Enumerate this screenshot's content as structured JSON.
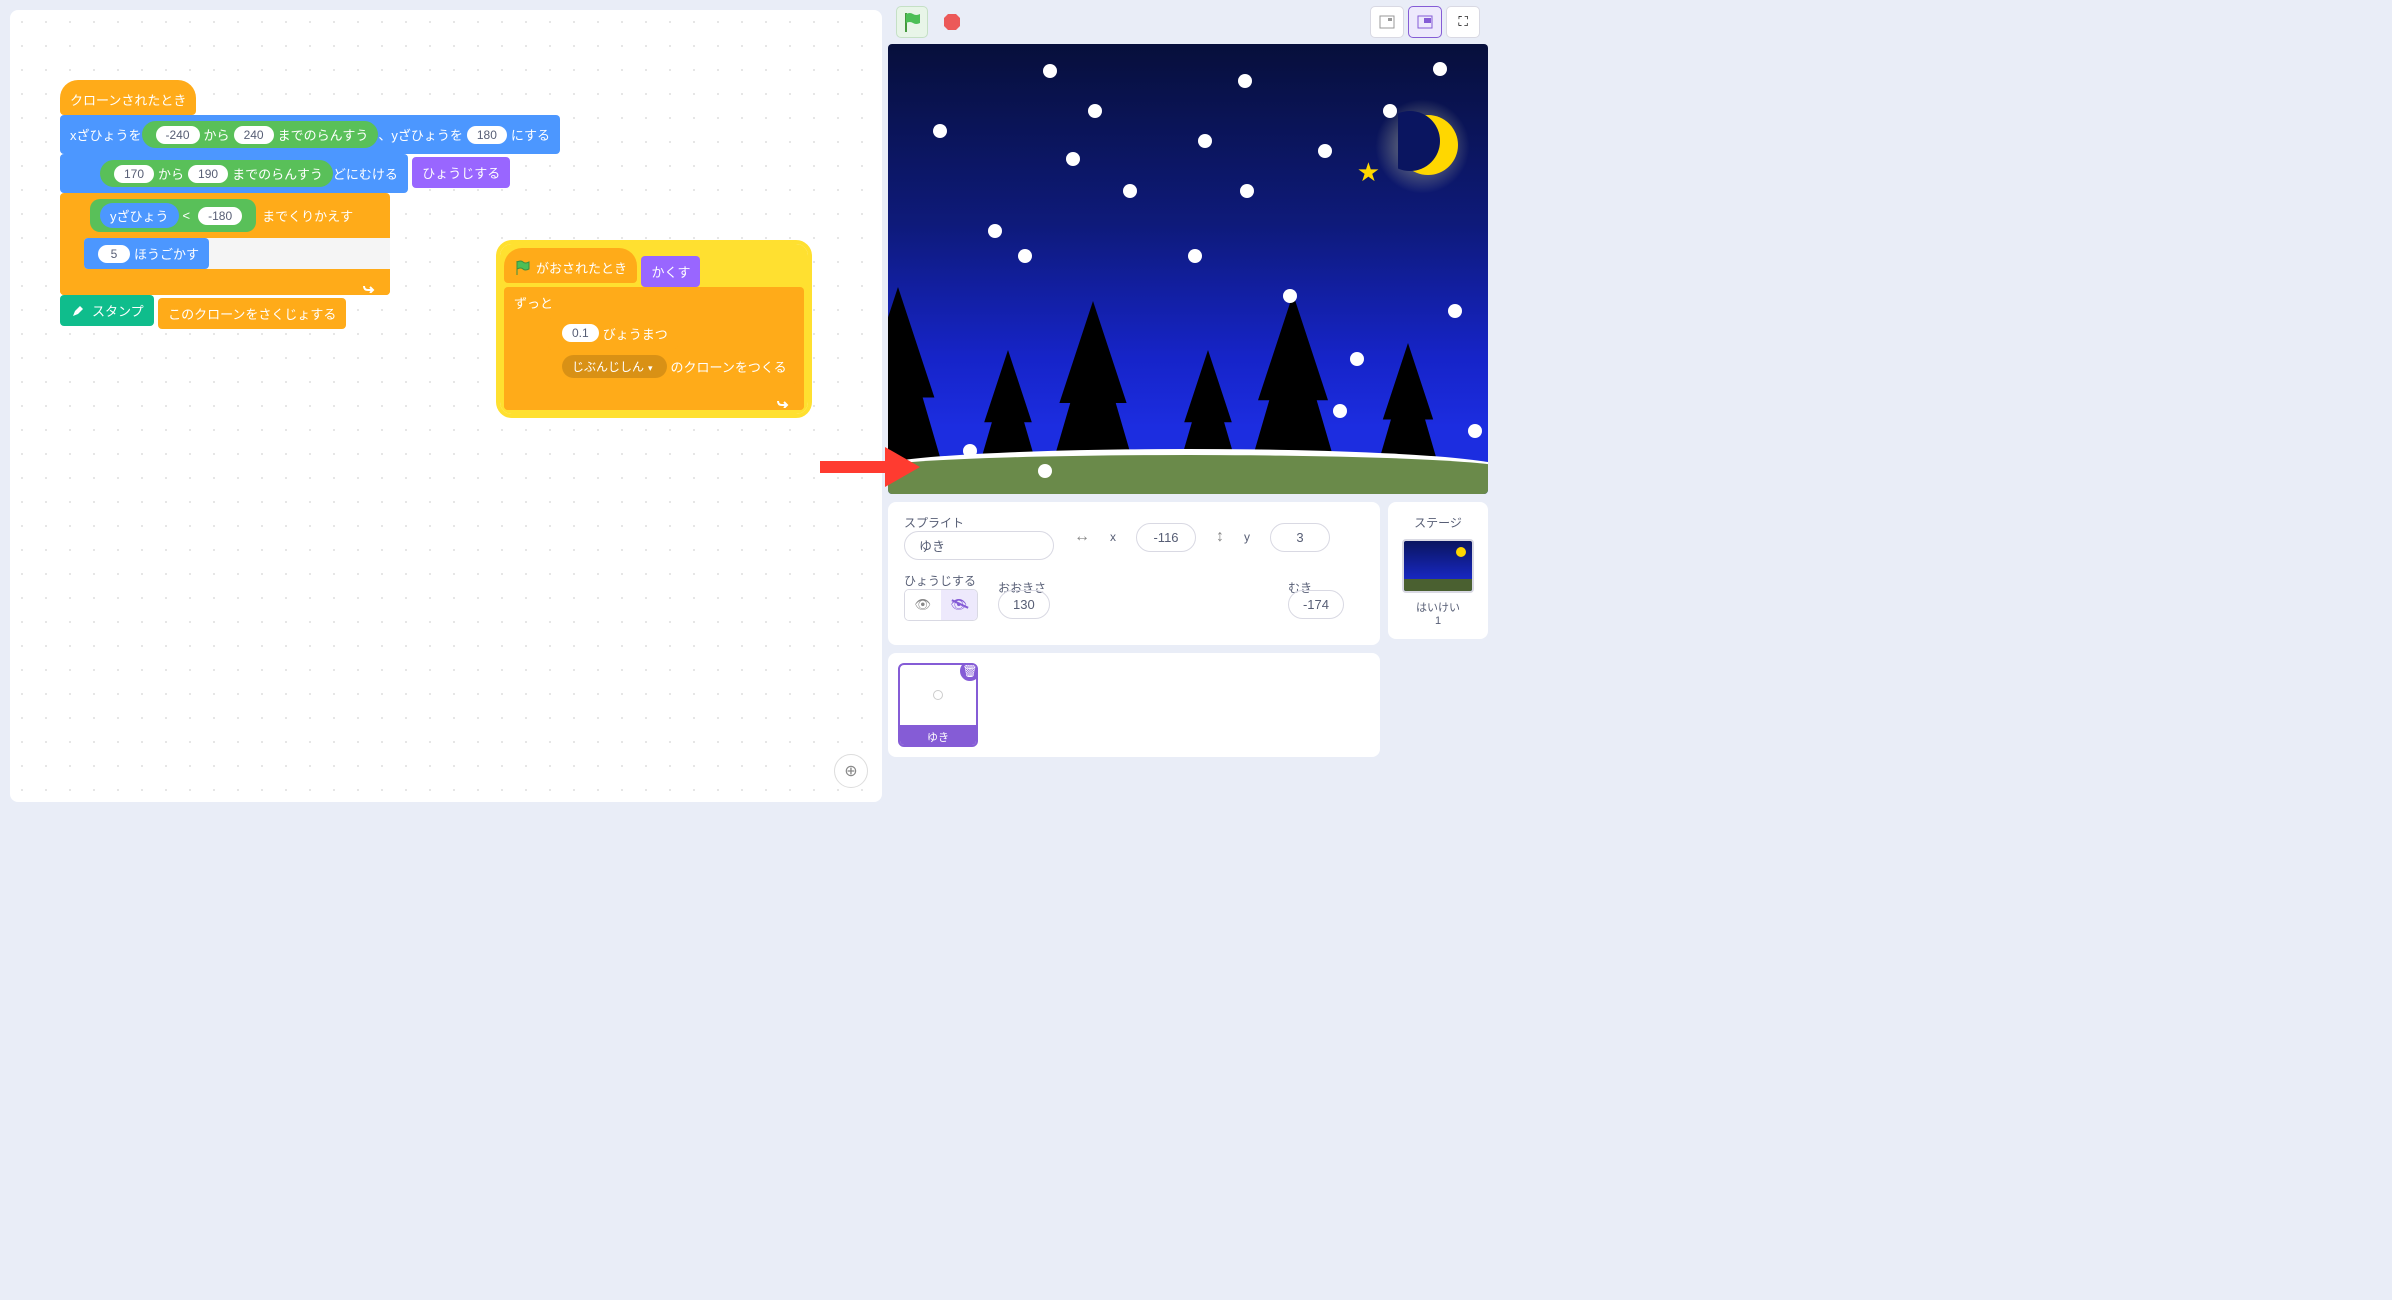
{
  "script1": {
    "hat": "クローンされたとき",
    "goto_pre": "xざひょうを",
    "rand1_from": "-240",
    "rand1_mid": "から",
    "rand1_to": "240",
    "rand1_suf": "までのらんすう",
    "goto_mid": "、yざひょうを",
    "goto_y": "180",
    "goto_suf": "にする",
    "point_from": "170",
    "point_mid": "から",
    "point_to": "190",
    "point_suf": "までのらんすう",
    "point_end": "どにむける",
    "show": "ひょうじする",
    "repeat_pre": "",
    "ypos": "yざひょう",
    "lt": "<",
    "neg180": "-180",
    "repeat_suf": "までくりかえす",
    "move_steps": "5",
    "move_suf": "ほうごかす",
    "stamp": "スタンプ",
    "delete_clone": "このクローンをさくじょする"
  },
  "script2": {
    "flag_hat": "がおされたとき",
    "hide": "かくす",
    "forever": "ずっと",
    "wait_val": "0.1",
    "wait_suf": "びょうまつ",
    "clone_target": "じぶんじしん",
    "clone_suf": "のクローンをつくる"
  },
  "sprite_panel": {
    "label": "スプライト",
    "name": "ゆき",
    "x_label": "x",
    "x": "-116",
    "y_label": "y",
    "y": "3",
    "show_label": "ひょうじする",
    "size_label": "おおきさ",
    "size": "130",
    "dir_label": "むき",
    "dir": "-174"
  },
  "stage_panel": {
    "title": "ステージ",
    "backdrop_label": "はいけい",
    "backdrop_count": "1"
  },
  "sprite_tile": {
    "name": "ゆき"
  }
}
